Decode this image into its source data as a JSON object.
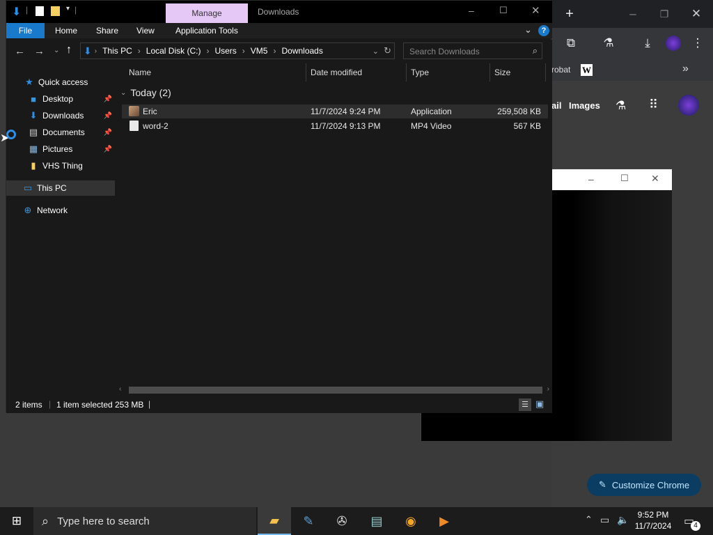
{
  "explorer": {
    "qat_dropdown": "▾",
    "ribbon_tabs": [
      "File",
      "Home",
      "Share",
      "View",
      "Application Tools"
    ],
    "context_tab": "Manage",
    "window_title": "Downloads",
    "breadcrumb": [
      "This PC",
      "Local Disk (C:)",
      "Users",
      "VM5",
      "Downloads"
    ],
    "search_placeholder": "Search Downloads",
    "nav": {
      "quick_access": "Quick access",
      "items": [
        "Desktop",
        "Downloads",
        "Documents",
        "Pictures",
        "VHS Thing"
      ],
      "this_pc": "This PC",
      "network": "Network"
    },
    "columns": {
      "name": "Name",
      "date": "Date modified",
      "type": "Type",
      "size": "Size"
    },
    "group_label": "Today (2)",
    "files": [
      {
        "name": "Eric",
        "date": "11/7/2024 9:24 PM",
        "type": "Application",
        "size": "259,508 KB"
      },
      {
        "name": "word-2",
        "date": "11/7/2024 9:13 PM",
        "type": "MP4 Video",
        "size": "567 KB"
      }
    ],
    "status": {
      "items": "2 items",
      "selected": "1 item selected",
      "size": "253 MB"
    }
  },
  "chrome": {
    "bookmark_partial": "robat",
    "wiki_letter": "W",
    "nav_partial": "ail",
    "images_link": "Images",
    "customize_button": "Customize Chrome"
  },
  "taskbar": {
    "search_placeholder": "Type here to search",
    "time": "9:52 PM",
    "date": "11/7/2024",
    "notification_count": "4"
  },
  "colors": {
    "accent": "#0078d7",
    "manage_tab": "#e5c8f6",
    "chrome_button": "#0b3d63"
  }
}
